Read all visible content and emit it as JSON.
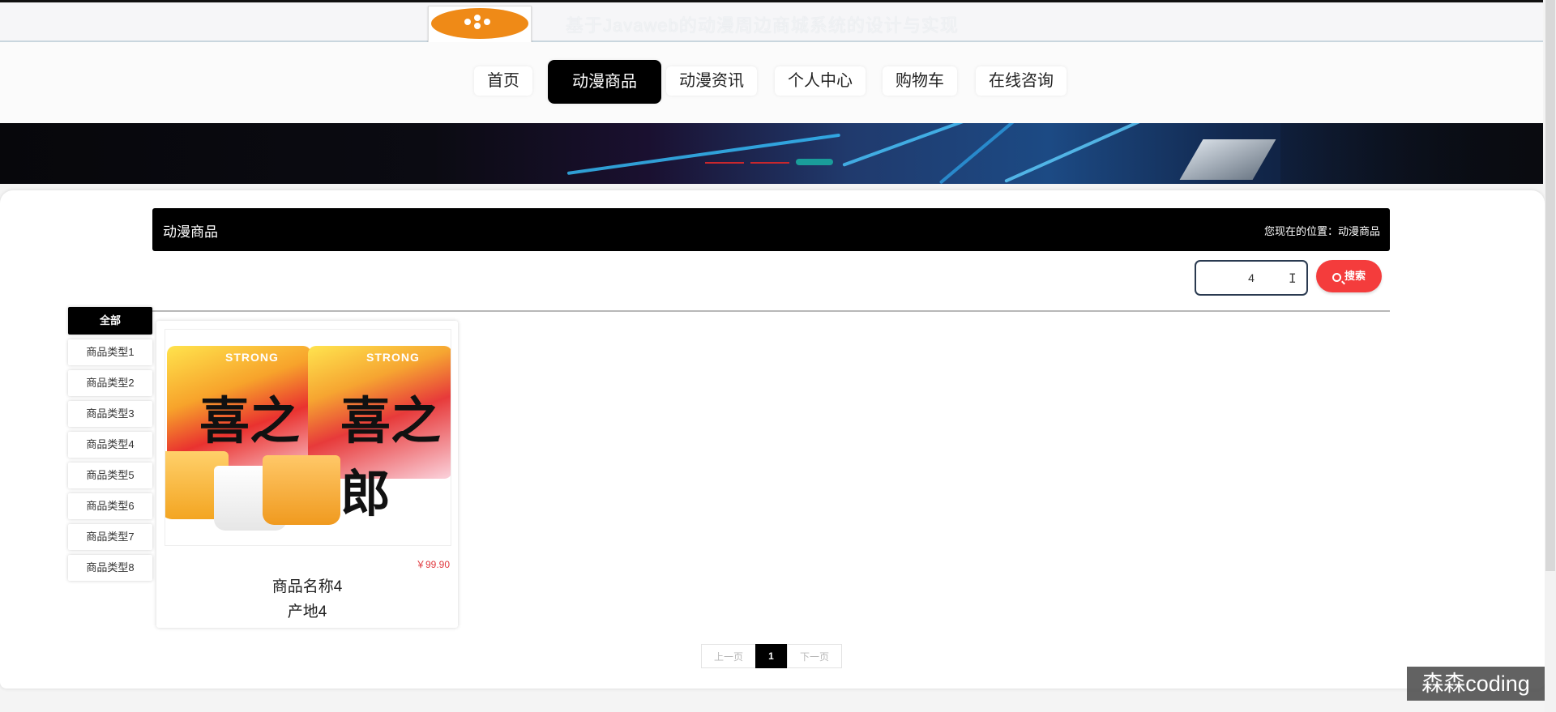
{
  "header": {
    "site_title": "基于Javaweb的动漫周边商城系统的设计与实现"
  },
  "nav": {
    "items": [
      {
        "label": "首页",
        "active": false
      },
      {
        "label": "动漫商品",
        "active": true
      },
      {
        "label": "动漫资讯",
        "active": false
      },
      {
        "label": "个人中心",
        "active": false
      },
      {
        "label": "购物车",
        "active": false
      },
      {
        "label": "在线咨询",
        "active": false
      }
    ]
  },
  "page": {
    "title": "动漫商品",
    "breadcrumb": "您现在的位置：动漫商品"
  },
  "search": {
    "value": "4",
    "button_label": "搜索"
  },
  "categories": [
    "全部",
    "商品类型1",
    "商品类型2",
    "商品类型3",
    "商品类型4",
    "商品类型5",
    "商品类型6",
    "商品类型7",
    "商品类型8"
  ],
  "product": {
    "price": "￥99.90",
    "name": "商品名称4",
    "origin": "产地4",
    "image_text": "喜之郎",
    "image_brand": "STRONG"
  },
  "pagination": {
    "prev": "上一页",
    "current": "1",
    "next": "下一页"
  },
  "watermark": "森森coding",
  "colors": {
    "accent_black": "#000000",
    "search_red": "#f43c3c",
    "price_red": "#e0393e",
    "logo_orange": "#ef8a17"
  }
}
